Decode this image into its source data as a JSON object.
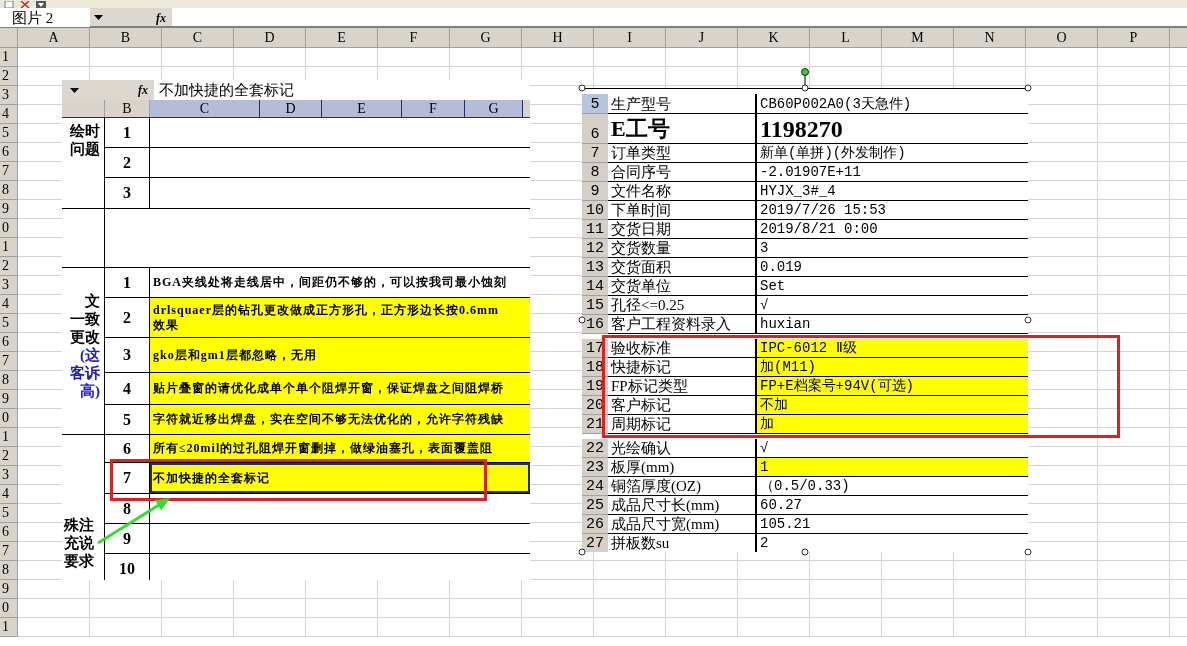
{
  "name_box": {
    "value": "图片 2"
  },
  "formula_bar": {
    "fx_label": "fx"
  },
  "column_headers": [
    "A",
    "B",
    "C",
    "D",
    "E",
    "F",
    "G",
    "H",
    "I",
    "J",
    "K",
    "L",
    "M",
    "N",
    "O",
    "P"
  ],
  "row_headers": [
    "1",
    "2",
    "3",
    "4",
    "5",
    "6",
    "7",
    "8",
    "9",
    "0",
    "1",
    "2",
    "3",
    "4",
    "5",
    "6",
    "7",
    "8",
    "9",
    "0",
    "1",
    "2",
    "3",
    "4",
    "5",
    "6",
    "7",
    "8",
    "9",
    "0",
    "1"
  ],
  "pictures": [
    {
      "kind": "notes_sheet",
      "selected": false,
      "fx_label": "fx",
      "formula_text": "不加快捷的全套标记",
      "columns": [
        {
          "label": "B",
          "selected": false
        },
        {
          "label": "C",
          "selected": true
        },
        {
          "label": "D",
          "selected": true
        },
        {
          "label": "E",
          "selected": true
        },
        {
          "label": "F",
          "selected": true
        },
        {
          "label": "G",
          "selected": true
        }
      ],
      "sections": [
        {
          "kind": "items",
          "label": [
            {
              "text": "绘时",
              "color": "#000000"
            },
            {
              "text": "问题",
              "color": "#000000"
            }
          ],
          "rows": [
            {
              "number": "1",
              "highlighted": false,
              "selected": false
            },
            {
              "number": "2",
              "highlighted": false,
              "selected": false
            },
            {
              "number": "3",
              "highlighted": false,
              "selected": false
            }
          ]
        },
        {
          "kind": "spacer"
        },
        {
          "kind": "items",
          "label": [
            {
              "text": "文",
              "color": "#000000"
            },
            {
              "text": "一致",
              "color": "#000000"
            },
            {
              "text": "更改",
              "color": "#000000"
            },
            {
              "text": "(这",
              "color": "#2020c0"
            },
            {
              "text": "客诉",
              "color": "#2020c0"
            },
            {
              "text": "高)",
              "color": "#2020c0"
            }
          ],
          "rows": [
            {
              "number": "1",
              "lines": [
                "BGA夹线处将走线居中，间距仍不够的，可以按我司最小蚀刻"
              ],
              "highlighted": false,
              "selected": false
            },
            {
              "number": "2",
              "lines": [
                "drlsquaer层的钻孔更改做成正方形孔，正方形边长按0.6mm",
                "效果"
              ],
              "highlighted": true,
              "selected": false
            },
            {
              "number": "3",
              "lines": [
                "gko层和gm1层都忽略，无用"
              ],
              "highlighted": true,
              "selected": false
            },
            {
              "number": "4",
              "lines": [
                "贴片叠窗的请优化成单个单个阻焊开窗，保证焊盘之间阻焊桥"
              ],
              "highlighted": true,
              "selected": false
            },
            {
              "number": "5",
              "lines": [
                "字符就近移出焊盘，实在空间不够无法优化的，允许字符残缺"
              ],
              "highlighted": true,
              "selected": false
            }
          ]
        },
        {
          "kind": "items",
          "label": [
            {
              "text": "殊注",
              "color": "#000000"
            },
            {
              "text": "充说",
              "color": "#000000"
            },
            {
              "text": "要求",
              "color": "#000000"
            }
          ],
          "rows": [
            {
              "number": "6",
              "lines": [
                "所有≤20mil的过孔阻焊开窗删掉，做绿油塞孔，表面覆盖阻"
              ],
              "highlighted": true,
              "selected": false
            },
            {
              "number": "7",
              "lines": [
                "不加快捷的全套标记"
              ],
              "highlighted": true,
              "selected": true
            },
            {
              "number": "8",
              "highlighted": false,
              "selected": false
            },
            {
              "number": "9",
              "highlighted": false,
              "selected": false
            },
            {
              "number": "10",
              "highlighted": false,
              "selected": false
            }
          ]
        }
      ]
    },
    {
      "kind": "order_sheet",
      "selected": true,
      "rows": [
        {
          "number": "5",
          "kind": "field",
          "selected": true,
          "label": "生产型号",
          "value": "CB60P002A0(3天急件)",
          "label_highlighted": false,
          "value_highlighted": false
        },
        {
          "number": "6",
          "kind": "title",
          "selected": false,
          "label": "E工号",
          "value": "1198270",
          "label_highlighted": false,
          "value_highlighted": false
        },
        {
          "number": "7",
          "kind": "field",
          "selected": false,
          "label": "订单类型",
          "value": "新单(单拼)(外发制作)",
          "label_highlighted": false,
          "value_highlighted": false
        },
        {
          "number": "8",
          "kind": "field",
          "selected": false,
          "label": "合同序号",
          "value": "-2.01907E+11",
          "label_highlighted": false,
          "value_highlighted": false
        },
        {
          "number": "9",
          "kind": "field",
          "selected": false,
          "label": "文件名称",
          "value": "HYJX_3#_4",
          "label_highlighted": false,
          "value_highlighted": false
        },
        {
          "number": "10",
          "kind": "field",
          "selected": false,
          "label": "下单时间",
          "value": "2019/7/26 15:53",
          "label_highlighted": false,
          "value_highlighted": false
        },
        {
          "number": "11",
          "kind": "field",
          "selected": false,
          "label": "交货日期",
          "value": "2019/8/21 0:00",
          "label_highlighted": false,
          "value_highlighted": false
        },
        {
          "number": "12",
          "kind": "field",
          "selected": false,
          "label": "交货数量",
          "value": "3",
          "label_highlighted": false,
          "value_highlighted": false
        },
        {
          "number": "13",
          "kind": "field",
          "selected": false,
          "label": "交货面积",
          "value": "0.019",
          "label_highlighted": false,
          "value_highlighted": false
        },
        {
          "number": "14",
          "kind": "field",
          "selected": false,
          "label": "交货单位",
          "value": "Set",
          "label_highlighted": false,
          "value_highlighted": false
        },
        {
          "number": "15",
          "kind": "field",
          "selected": false,
          "label": "孔径<=0.25",
          "value": "√",
          "label_highlighted": false,
          "value_highlighted": false
        },
        {
          "number": "16",
          "kind": "field",
          "selected": false,
          "label": "客户工程资料录入",
          "value": "huxian",
          "label_highlighted": false,
          "value_highlighted": false
        },
        {
          "number": "17",
          "kind": "field",
          "selected": false,
          "label": "验收标准",
          "value": "IPC-6012 Ⅱ级",
          "label_highlighted": false,
          "value_highlighted": true
        },
        {
          "number": "18",
          "kind": "field",
          "selected": false,
          "label": "快捷标记",
          "value": "加(M11)",
          "label_highlighted": false,
          "value_highlighted": true
        },
        {
          "number": "19",
          "kind": "field",
          "selected": false,
          "label": "FP标记类型",
          "value": "FP+E档案号+94V(可选)",
          "label_highlighted": false,
          "value_highlighted": true
        },
        {
          "number": "20",
          "kind": "field",
          "selected": false,
          "label": "客户标记",
          "value": "不加",
          "label_highlighted": false,
          "value_highlighted": true
        },
        {
          "number": "21",
          "kind": "field",
          "selected": false,
          "label": "周期标记",
          "value": "加",
          "label_highlighted": false,
          "value_highlighted": true
        },
        {
          "number": "22",
          "kind": "field",
          "selected": false,
          "label": "光绘确认",
          "value": "√",
          "label_highlighted": false,
          "value_highlighted": false
        },
        {
          "number": "23",
          "kind": "field",
          "selected": false,
          "label": "板厚(mm)",
          "value": "1",
          "label_highlighted": false,
          "value_highlighted": true
        },
        {
          "number": "24",
          "kind": "field",
          "selected": false,
          "label": "铜箔厚度(OZ)",
          "value": "（0.5/0.33)",
          "label_highlighted": false,
          "value_highlighted": false
        },
        {
          "number": "25",
          "kind": "field",
          "selected": false,
          "label": "成品尺寸长(mm)",
          "value": "60.27",
          "label_highlighted": false,
          "value_highlighted": false
        },
        {
          "number": "26",
          "kind": "field",
          "selected": false,
          "label": "成品尺寸宽(mm)",
          "value": "105.21",
          "label_highlighted": false,
          "value_highlighted": false
        },
        {
          "number": "27",
          "kind": "field",
          "selected": false,
          "label": "拼板数su",
          "value": "2",
          "label_highlighted": false,
          "value_highlighted": false
        }
      ]
    }
  ]
}
